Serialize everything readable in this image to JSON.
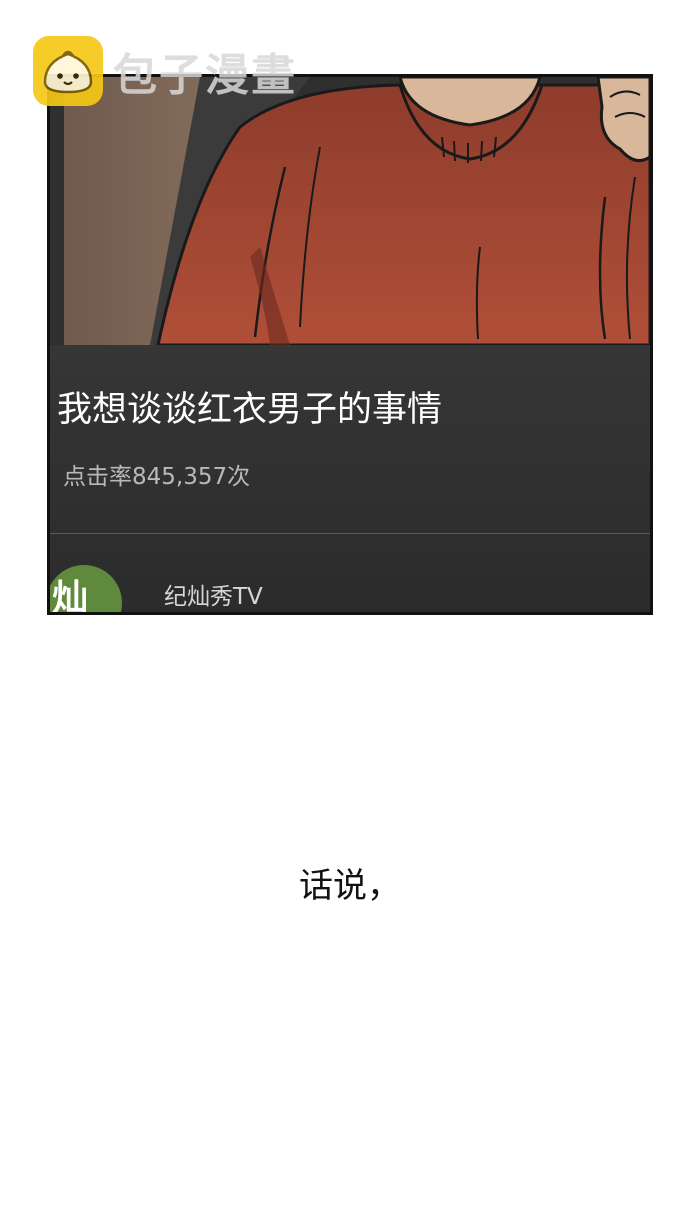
{
  "watermark": {
    "brand_text": "包子漫畫",
    "logo_color": "#f5c816"
  },
  "panel": {
    "video_title": "我想谈谈红衣男子的事情",
    "view_count": "点击率845,357次",
    "channel_name": "纪灿秀TV",
    "avatar_glyph": "灿",
    "sweater_color": "#a84a35",
    "info_bg_color": "#333333",
    "avatar_color": "#5f8a3c"
  },
  "caption": {
    "text": "话说，"
  }
}
